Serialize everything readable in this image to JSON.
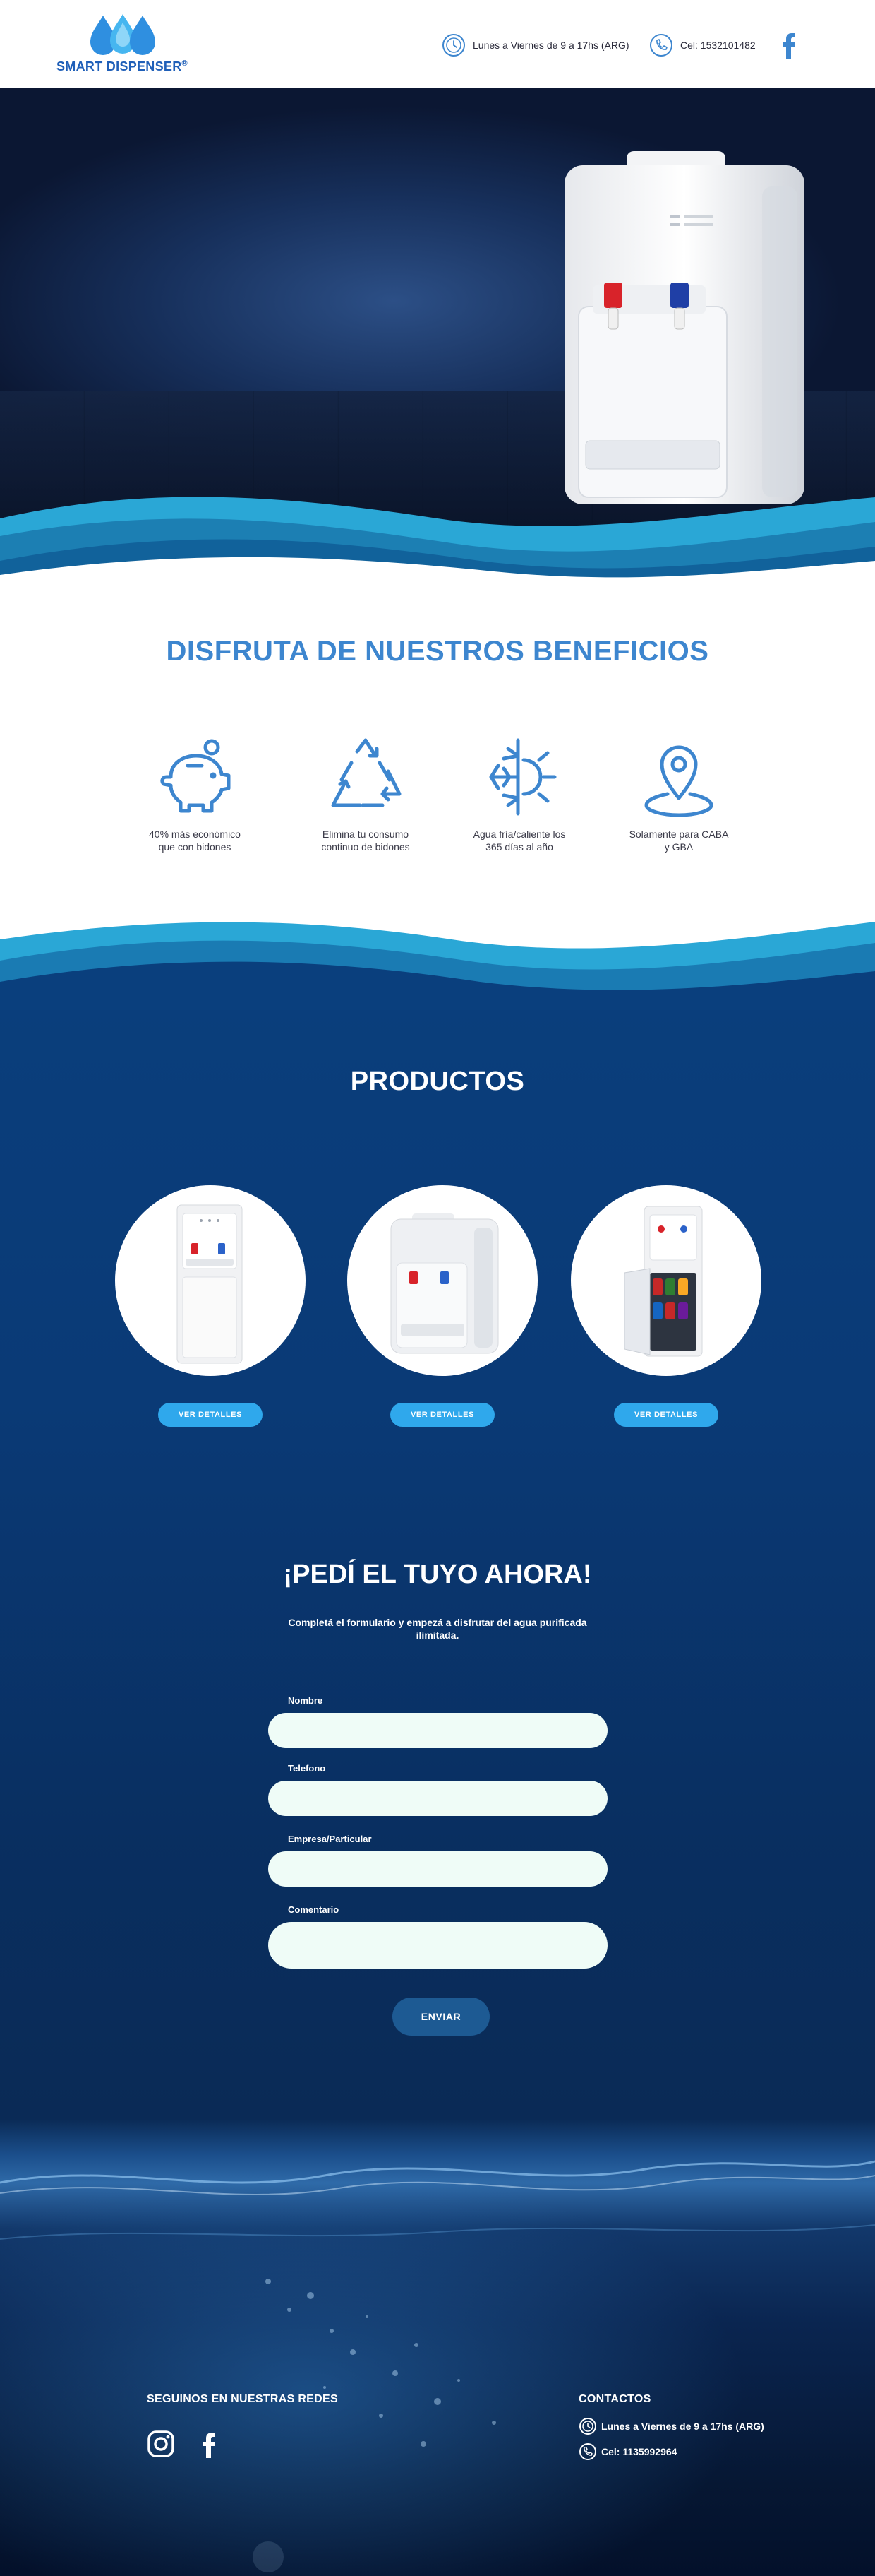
{
  "header": {
    "brand": "SMART DISPENSER",
    "brand_mark": "®",
    "hours": "Lunes a Viernes de 9 a 17hs (ARG)",
    "phone": "Cel: 1532101482",
    "icons": {
      "hours": "clock-icon",
      "phone": "phone-icon",
      "social": "facebook-icon"
    },
    "colors": {
      "brand": "#1f5fb8",
      "accent": "#3d86cf"
    }
  },
  "benefits": {
    "title": "DISFRUTA DE NUESTROS BENEFICIOS",
    "items": [
      {
        "icon": "piggy-bank-icon",
        "line1": "40% más económico",
        "line2": "que con bidones"
      },
      {
        "icon": "recycle-icon",
        "line1": "Elimina tu consumo",
        "line2": "continuo de bidones"
      },
      {
        "icon": "cold-hot-icon",
        "line1": "Agua fría/caliente los",
        "line2": "365 días al año"
      },
      {
        "icon": "location-pin-icon",
        "line1": "Solamente para CABA",
        "line2": "y GBA"
      }
    ]
  },
  "products": {
    "title": "PRODUCTOS",
    "items": [
      {
        "image": "standing-dispenser",
        "button": "VER DETALLES"
      },
      {
        "image": "countertop-dispenser",
        "button": "VER DETALLES"
      },
      {
        "image": "fridge-dispenser",
        "button": "VER DETALLES"
      }
    ],
    "colors": {
      "button": "#2fa8ec"
    }
  },
  "order": {
    "title": "¡PEDÍ EL TUYO AHORA!",
    "subtitle_line1": "Completá el formulario y empezá a disfrutar del agua purificada",
    "subtitle_line2": "ilimitada.",
    "fields": {
      "name_label": "Nombre",
      "phone_label": "Telefono",
      "company_label": "Empresa/Particular",
      "comment_label": "Comentario"
    },
    "submit": "ENVIAR"
  },
  "footer": {
    "social_title": "SEGUINOS EN NUESTRAS REDES",
    "social_icons": [
      "instagram-icon",
      "facebook-icon"
    ],
    "contacts_title": "CONTACTOS",
    "hours": "Lunes a Viernes de 9 a 17hs (ARG)",
    "phone": "Cel: 1135992964"
  }
}
